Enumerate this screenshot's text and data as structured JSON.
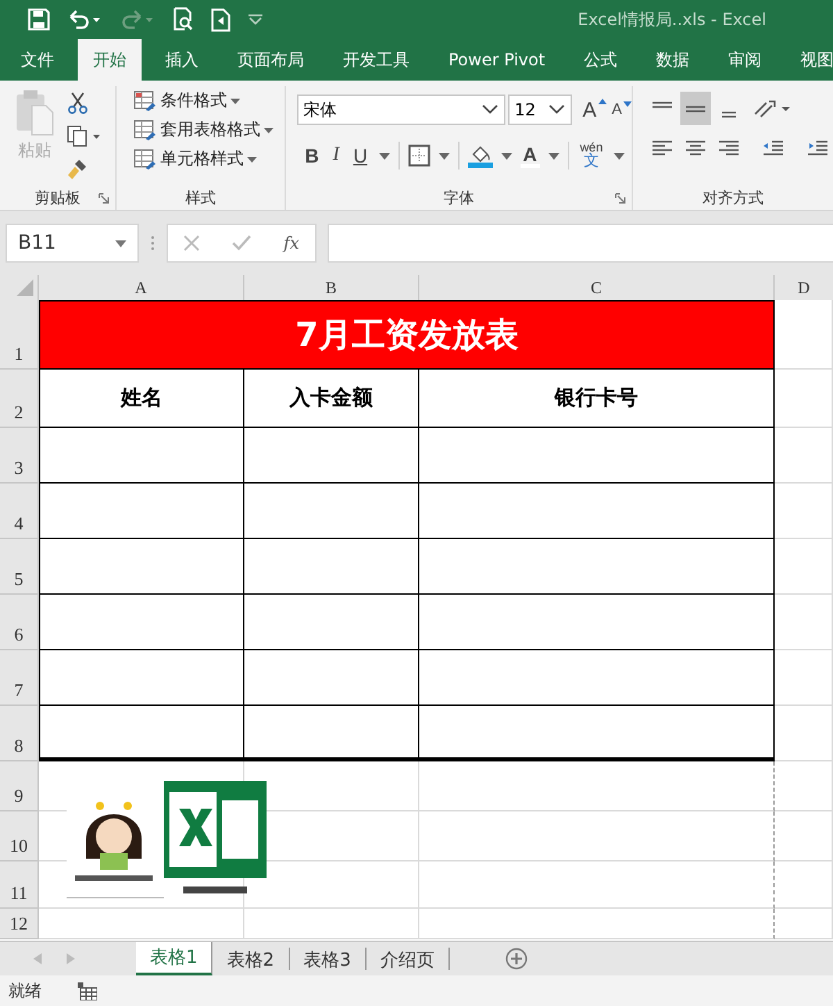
{
  "window": {
    "title": "Excel情报局..xls  -  Excel"
  },
  "tabs": [
    {
      "label": "文件",
      "selected": false
    },
    {
      "label": "开始",
      "selected": true
    },
    {
      "label": "插入",
      "selected": false
    },
    {
      "label": "页面布局",
      "selected": false
    },
    {
      "label": "开发工具",
      "selected": false
    },
    {
      "label": "Power Pivot",
      "selected": false
    },
    {
      "label": "公式",
      "selected": false
    },
    {
      "label": "数据",
      "selected": false
    },
    {
      "label": "审阅",
      "selected": false
    },
    {
      "label": "视图",
      "selected": false
    }
  ],
  "ribbon": {
    "clipboard": {
      "paste": "粘贴",
      "paste_disabled": true,
      "label": "剪贴板"
    },
    "styles": {
      "items": [
        "条件格式",
        "套用表格格式",
        "单元格样式"
      ],
      "label": "样式"
    },
    "font": {
      "name": "宋体",
      "size": "12",
      "grow": "A",
      "shrink": "A",
      "bold": "B",
      "italic": "I",
      "underline": "U",
      "color_letter": "A",
      "phonetic_top": "wén",
      "phonetic_bottom": "文",
      "label": "字体"
    },
    "alignment": {
      "buttons": [
        {
          "kind": "top",
          "selected": false
        },
        {
          "kind": "middle",
          "selected": true
        },
        {
          "kind": "bottom",
          "selected": false
        },
        {
          "kind": "orientation",
          "selected": false
        },
        {
          "kind": "left",
          "selected": false
        },
        {
          "kind": "center",
          "selected": false
        },
        {
          "kind": "right",
          "selected": false
        },
        {
          "kind": "outdent",
          "selected": false
        },
        {
          "kind": "indent",
          "selected": false
        }
      ],
      "label": "对齐方式"
    }
  },
  "formula_bar": {
    "name_box": "B11",
    "fx": "fx"
  },
  "sheet": {
    "columns": [
      "A",
      "B",
      "C",
      "D"
    ],
    "rows": [
      "1",
      "2",
      "3",
      "4",
      "5",
      "6",
      "7",
      "8",
      "9",
      "10",
      "11",
      "12"
    ],
    "title": "7月工资发放表",
    "headers": [
      "姓名",
      "入卡金额",
      "银行卡号"
    ]
  },
  "sheet_tabs": [
    {
      "label": "表格1",
      "selected": true
    },
    {
      "label": "表格2",
      "selected": false
    },
    {
      "label": "表格3",
      "selected": false
    },
    {
      "label": "介绍页",
      "selected": false
    }
  ],
  "status_bar": {
    "text": "就绪"
  }
}
